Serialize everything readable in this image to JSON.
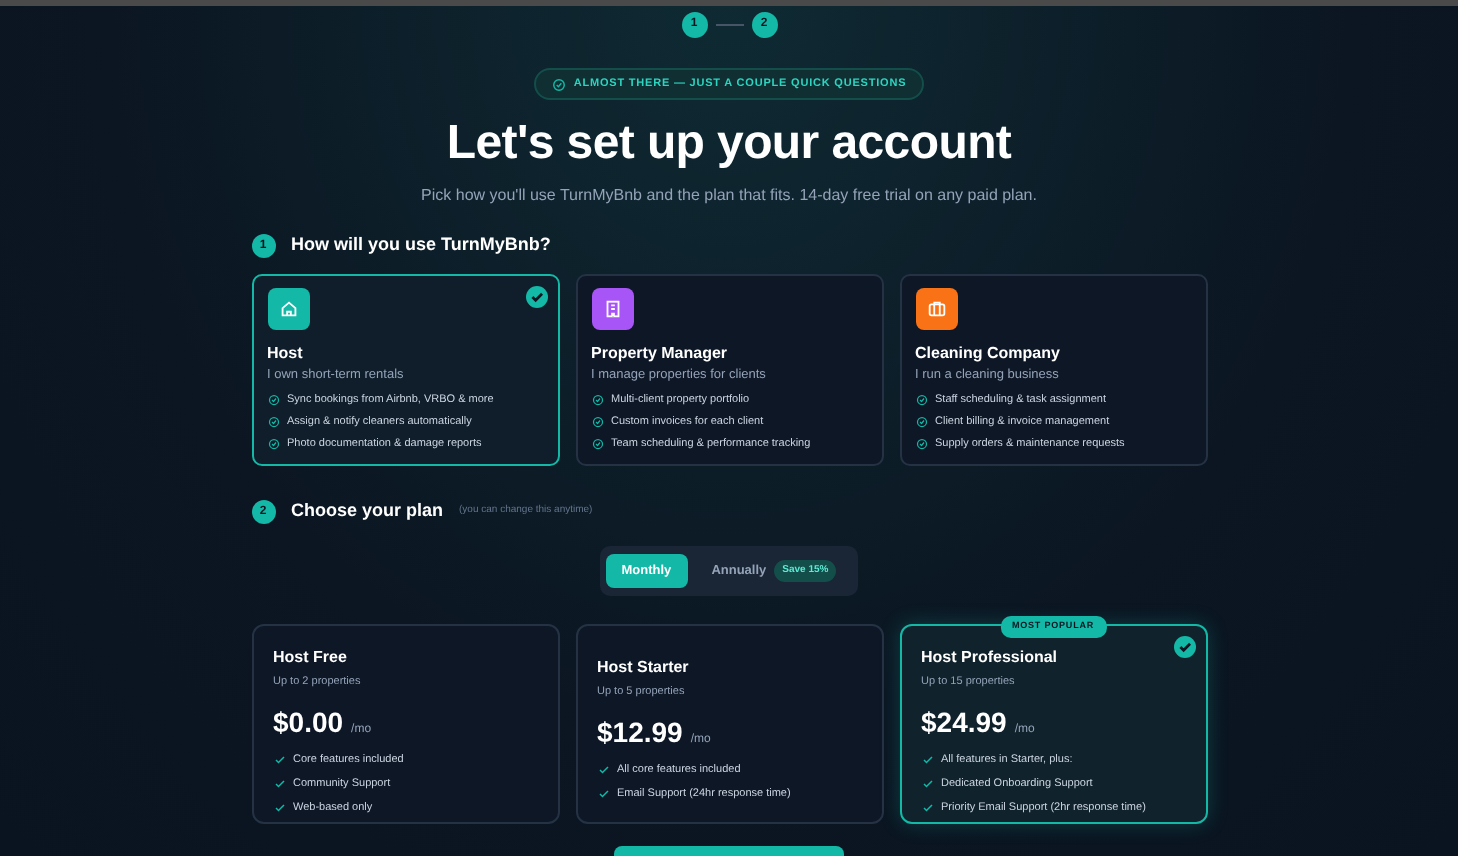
{
  "stepper": [
    {
      "label": "1",
      "selected": true
    },
    {
      "label": "2",
      "selected": true
    }
  ],
  "badge": "ALMOST THERE — JUST A COUPLE QUICK QUESTIONS",
  "title": "Let's set up your account",
  "subtitle": "Pick how you'll use TurnMyBnb and the plan that fits. 14-day free trial on any paid plan.",
  "section_1": {
    "number": "1",
    "title": "How will you use TurnMyBnb?"
  },
  "roles": [
    {
      "kind": "house",
      "color": "#14b8a6",
      "title": "Host",
      "subtitle": "I own short-term rentals",
      "selected": true,
      "features": [
        "Sync bookings from Airbnb, VRBO & more",
        "Assign & notify cleaners automatically",
        "Photo documentation & damage reports"
      ]
    },
    {
      "kind": "building",
      "color": "#a855f7",
      "title": "Property Manager",
      "subtitle": "I manage properties for clients",
      "selected": false,
      "features": [
        "Multi-client property portfolio",
        "Custom invoices for each client",
        "Team scheduling & performance tracking"
      ]
    },
    {
      "kind": "briefcase",
      "color": "#f97316",
      "title": "Cleaning Company",
      "subtitle": "I run a cleaning business",
      "selected": false,
      "features": [
        "Staff scheduling & task assignment",
        "Client billing & invoice management",
        "Supply orders & maintenance requests"
      ]
    }
  ],
  "section_2": {
    "number": "2",
    "title": "Choose your plan",
    "note": "(you can change this anytime)"
  },
  "billing": [
    {
      "label": "Monthly",
      "selected": true
    },
    {
      "label": "Annually",
      "selected": false,
      "tag": "Save 15%"
    }
  ],
  "plans": [
    {
      "name": "Host Free",
      "limit": "Up to 2 properties",
      "price": "$0.00",
      "period": "/mo",
      "selected": false,
      "features": [
        "Core features included",
        "Community Support",
        "Web-based only"
      ]
    },
    {
      "name": "Host Starter",
      "limit": "Up to 5 properties",
      "price": "$12.99",
      "period": "/mo",
      "selected": false,
      "features": [
        "All core features included",
        "Email Support (24hr response time)"
      ]
    },
    {
      "name": "Host Professional",
      "limit": "Up to 15 properties",
      "price": "$24.99",
      "period": "/mo",
      "selected": true,
      "ribbon": "MOST POPULAR",
      "features": [
        "All features in Starter, plus:",
        "Dedicated Onboarding Support",
        "Priority Email Support (2hr response time)"
      ]
    }
  ]
}
